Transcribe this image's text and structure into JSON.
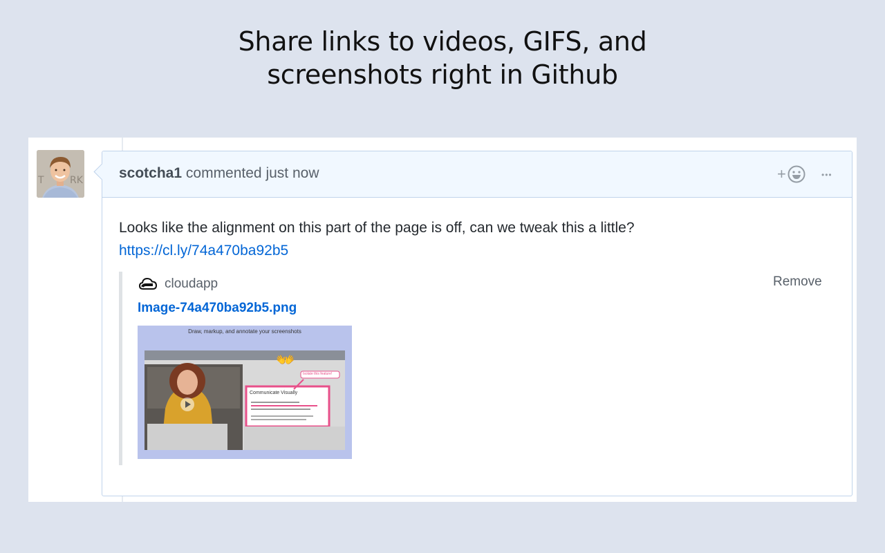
{
  "headline": {
    "line1": "Share links to videos, GIFS, and",
    "line2": "screenshots right in Github"
  },
  "comment": {
    "author": "scotcha1",
    "action": "commented just now",
    "body_text": "Looks like the alignment on this part of the page is off, can we tweak this a little?",
    "link": "https://cl.ly/74a470ba92b5",
    "reaction_plus": "+",
    "more_label": "•••",
    "icons": {
      "avatar": "avatar",
      "reaction": "smiley-icon",
      "more": "ellipsis-icon",
      "provider": "cloud-icon",
      "play": "play-icon"
    }
  },
  "embed": {
    "provider": "cloudapp",
    "remove_label": "Remove",
    "title": "Image-74a470ba92b5.png",
    "thumbnail": {
      "caption": "Draw, markup, and annotate your screenshots",
      "card_title": "Communicate Visually",
      "callout": "Isolate this feature!"
    }
  },
  "colors": {
    "background": "#dde3ee",
    "header_bg": "#f1f8ff",
    "border": "#c0d3eb",
    "link": "#0366d6",
    "muted": "#586069"
  }
}
